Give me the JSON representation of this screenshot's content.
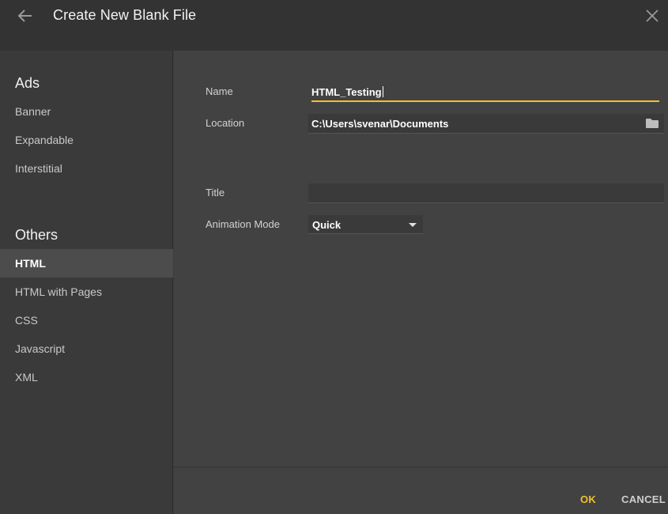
{
  "header": {
    "title": "Create New Blank File",
    "back_icon": "arrow-left-icon",
    "close_icon": "close-icon"
  },
  "sidebar": {
    "sections": [
      {
        "title": "Ads",
        "items": [
          "Banner",
          "Expandable",
          "Interstitial"
        ]
      },
      {
        "title": "Others",
        "items": [
          "HTML",
          "HTML with Pages",
          "CSS",
          "Javascript",
          "XML"
        ]
      }
    ],
    "selected": "HTML"
  },
  "form": {
    "name_label": "Name",
    "name_value": "HTML_Testing",
    "location_label": "Location",
    "location_value": "C:\\Users\\svenar\\Documents",
    "location_icon": "folder-icon",
    "title_label": "Title",
    "title_value": "",
    "animation_label": "Animation Mode",
    "animation_value": "Quick"
  },
  "footer": {
    "ok_label": "OK",
    "cancel_label": "CANCEL"
  },
  "colors": {
    "accent": "#f2c02a",
    "header_bg": "#333333",
    "sidebar_bg": "#3a3a3a",
    "main_bg": "#424242",
    "selected_bg": "#4c4c4c"
  }
}
